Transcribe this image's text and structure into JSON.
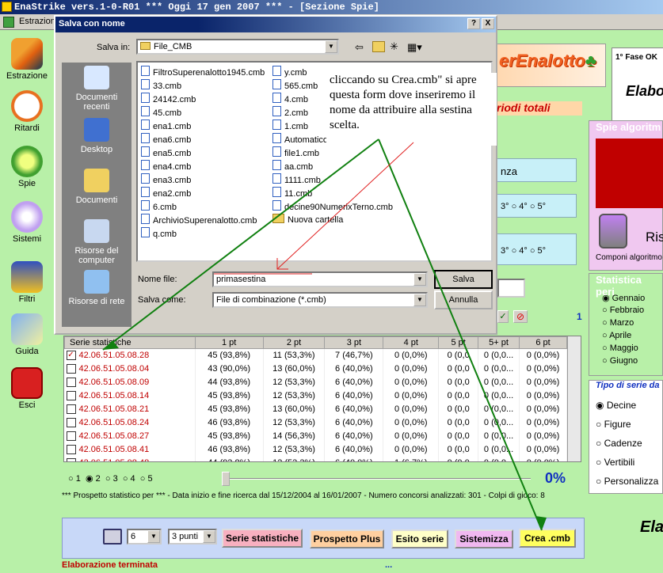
{
  "app": {
    "title": "EnaStrike vers.1-0-R01  ***  Oggi 17 gen 2007  ***  - [Sezione Spie]",
    "menu_first": "Estrazion"
  },
  "sidebar": {
    "items": [
      {
        "label": "Estrazione",
        "icon": "pencil-icon"
      },
      {
        "label": "Ritardi",
        "icon": "clock-icon"
      },
      {
        "label": "Spie",
        "icon": "flashlight-icon"
      },
      {
        "label": "Sistemi",
        "icon": "lightbulb-icon"
      },
      {
        "label": "Filtri",
        "icon": "filter-icon"
      },
      {
        "label": "Guida",
        "icon": "book-icon"
      },
      {
        "label": "Esci",
        "icon": "exit-icon"
      }
    ]
  },
  "right_panel": {
    "logo_text": "erEnalotto",
    "fase": "1° Fase OK",
    "elabo": "Elabo",
    "periodi": "riodi totali",
    "spie_title": "Spie algoritm",
    "ris": "Ris",
    "componi": "Componi algoritmo",
    "nza": "nza",
    "pt_row1": "3°  ○ 4°  ○ 5°",
    "pt_row2": "3°  ○ 4°  ○ 5°",
    "stat_title": "Statistica peri",
    "months": [
      "Gennaio",
      "Febbraio",
      "Marzo",
      "Aprile",
      "Maggio",
      "Giugno"
    ],
    "tipo_title": "Tipo di serie da",
    "tipi": [
      "Decine",
      "Figure",
      "Cadenze",
      "Vertibili",
      "Personalizza"
    ],
    "ela": "Ela",
    "one": "1"
  },
  "table": {
    "headers": [
      "Serie statistiche",
      "1 pt",
      "2 pt",
      "3 pt",
      "4 pt",
      "5 pt",
      "5+ pt",
      "6 pt"
    ],
    "rows": [
      {
        "serie": "42.06.51.05.08.28",
        "checked": true,
        "c1": "45 (93,8%)",
        "c2": "11 (53,3%)",
        "c3": "7 (46,7%)",
        "c4": "0 (0,0%)",
        "c5": "0 (0,0",
        "c6": "0 (0,0...",
        "c7": "0 (0,0%)"
      },
      {
        "serie": "42.06.51.05.08.04",
        "checked": false,
        "c1": "43 (90,0%)",
        "c2": "13 (60,0%)",
        "c3": "6 (40,0%)",
        "c4": "0 (0,0%)",
        "c5": "0 (0,0",
        "c6": "0 (0,0...",
        "c7": "0 (0,0%)"
      },
      {
        "serie": "42.06.51.05.08.09",
        "checked": false,
        "c1": "44 (93,8%)",
        "c2": "12 (53,3%)",
        "c3": "6 (40,0%)",
        "c4": "0 (0,0%)",
        "c5": "0 (0,0",
        "c6": "0 (0,0...",
        "c7": "0 (0,0%)"
      },
      {
        "serie": "42.06.51.05.08.14",
        "checked": false,
        "c1": "45 (93,8%)",
        "c2": "12 (53,3%)",
        "c3": "6 (40,0%)",
        "c4": "0 (0,0%)",
        "c5": "0 (0,0",
        "c6": "0 (0,0...",
        "c7": "0 (0,0%)"
      },
      {
        "serie": "42.06.51.05.08.21",
        "checked": false,
        "c1": "45 (93,8%)",
        "c2": "13 (60,0%)",
        "c3": "6 (40,0%)",
        "c4": "0 (0,0%)",
        "c5": "0 (0,0",
        "c6": "0 (0,0...",
        "c7": "0 (0,0%)"
      },
      {
        "serie": "42.06.51.05.08.24",
        "checked": false,
        "c1": "46 (93,8%)",
        "c2": "12 (53,3%)",
        "c3": "6 (40,0%)",
        "c4": "0 (0,0%)",
        "c5": "0 (0,0",
        "c6": "0 (0,0...",
        "c7": "0 (0,0%)"
      },
      {
        "serie": "42.06.51.05.08.27",
        "checked": false,
        "c1": "45 (93,8%)",
        "c2": "14 (56,3%)",
        "c3": "6 (40,0%)",
        "c4": "0 (0,0%)",
        "c5": "0 (0,0",
        "c6": "0 (0,0...",
        "c7": "0 (0,0%)"
      },
      {
        "serie": "42.06.51.05.08.41",
        "checked": false,
        "c1": "46 (93,8%)",
        "c2": "12 (53,3%)",
        "c3": "6 (40,0%)",
        "c4": "0 (0,0%)",
        "c5": "0 (0,0",
        "c6": "0 (0,0...",
        "c7": "0 (0,0%)"
      },
      {
        "serie": "42.06.51.05.08.48",
        "checked": false,
        "c1": "44 (93,8%)",
        "c2": "12 (53,3%)",
        "c3": "6 (40,0%)",
        "c4": "1 (6,7%)",
        "c5": "0 (0,0",
        "c6": "0 (0,0...",
        "c7": "0 (0,0%)"
      }
    ]
  },
  "radios": [
    "1",
    "2",
    "3",
    "4",
    "5"
  ],
  "radio_selected": "2",
  "progress": {
    "text": "0%",
    "value": 0
  },
  "prospetto": "*** Prospetto statistico per  ***  - Data inizio e fine ricerca dal 15/12/2004 al 16/01/2007 - Numero concorsi analizzati: 301 - Colpi di gioco: 8",
  "bottom": {
    "num_select": "6",
    "punti_select": "3 punti",
    "buttons": [
      "Serie statistiche",
      "Prospetto Plus",
      "Esito serie",
      "Sistemizza",
      "Crea .cmb"
    ],
    "button_colors": [
      "#f8b0c0",
      "#ffd0a0",
      "#ffffc8",
      "#f0b8f0",
      "#ffff60"
    ]
  },
  "status": {
    "text": "Elaborazione terminata",
    "dots": "..."
  },
  "dialog": {
    "title": "Salva con nome",
    "salva_in_label": "Salva in:",
    "folder": "File_CMB",
    "places": [
      "Documenti recenti",
      "Desktop",
      "Documenti",
      "Risorse del computer",
      "Risorse di rete"
    ],
    "files_col1": [
      "FiltroSuperenalotto1945.cmb",
      "33.cmb",
      "24142.cmb",
      "45.cmb",
      "ena1.cmb",
      "ena6.cmb",
      "ena5.cmb",
      "ena4.cmb",
      "ena3.cmb",
      "ena2.cmb",
      "6.cmb",
      "ArchivioSuperenalotto.cmb",
      "q.cmb"
    ],
    "files_col2": [
      "y.cmb",
      "565.cmb",
      "4.cmb",
      "2.cmb",
      "1.cmb",
      "Automatico.cmb",
      "file1.cmb",
      "aa.cmb",
      "1111.cmb",
      "11.cmb",
      "decine90NumerixTerno.cmb"
    ],
    "folder_item": "Nuova cartella",
    "nome_file_label": "Nome file:",
    "nome_file_value": "primasestina",
    "salva_come_label": "Salva come:",
    "salva_come_value": "File di combinazione (*.cmb)",
    "salva_btn": "Salva",
    "annulla_btn": "Annulla",
    "help_btn": "?",
    "close_btn": "X"
  },
  "annotation": "cliccando su Crea.cmb\" si apre questa form dove inseriremo il nome da attribuire alla sestina scelta."
}
